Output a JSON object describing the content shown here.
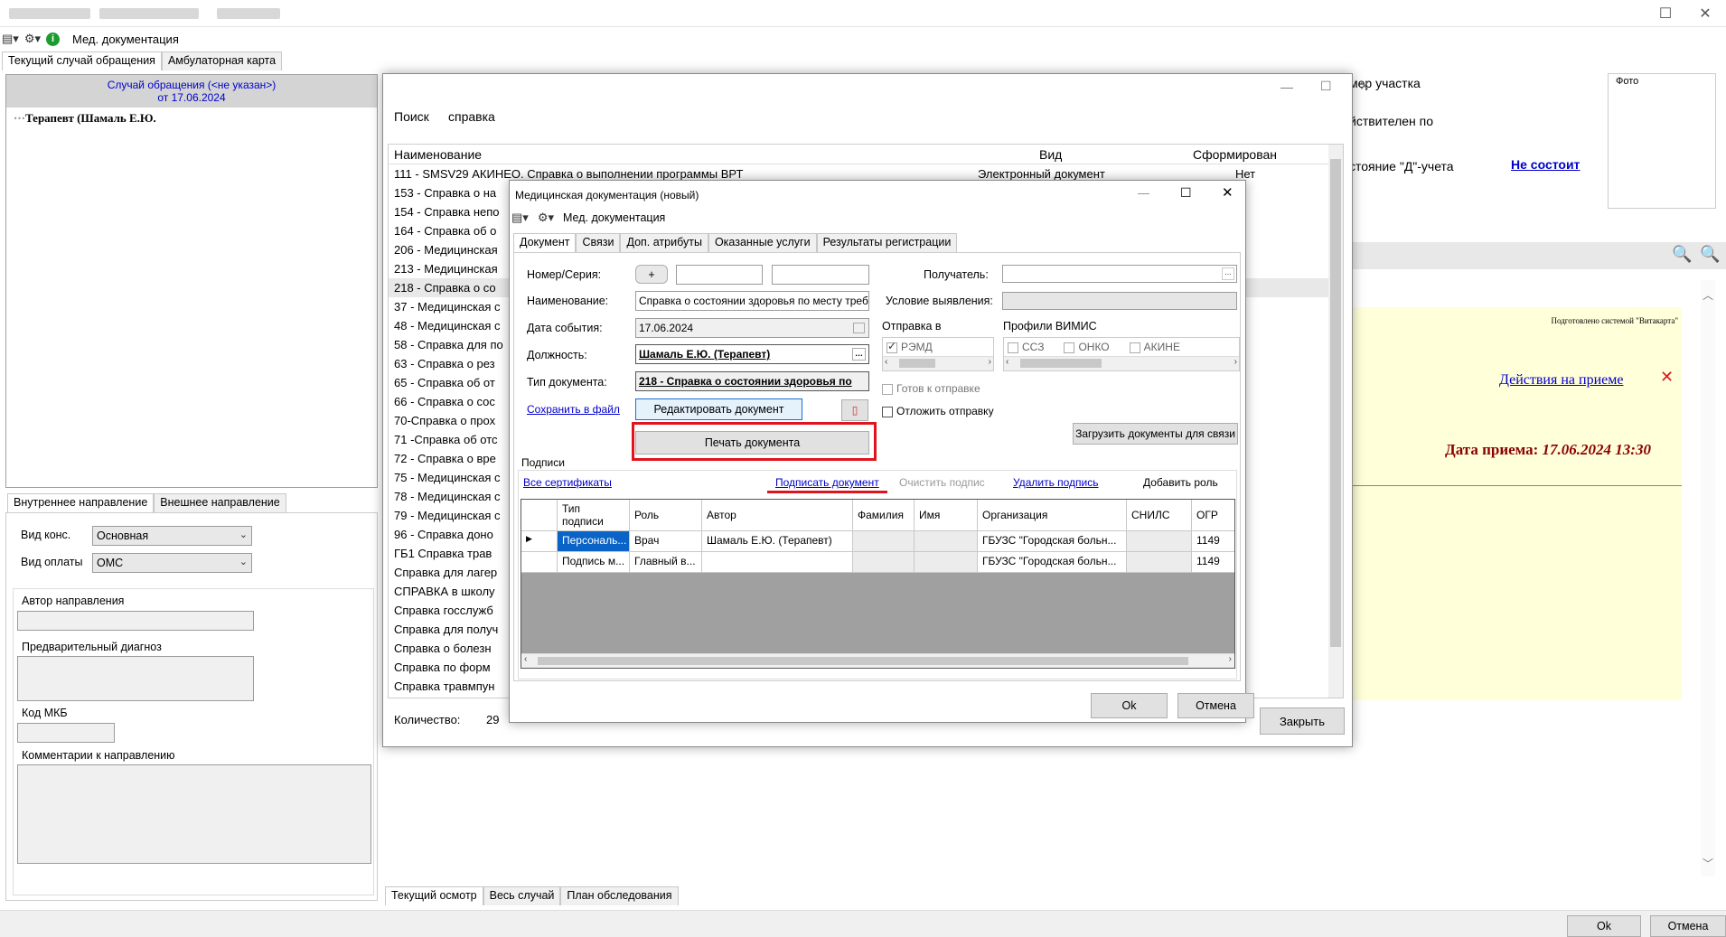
{
  "main": {
    "toolbar": {
      "med_docs": "Мед. документация"
    },
    "tabs": [
      "Текущий случай обращения",
      "Амбулаторная карта"
    ],
    "case": {
      "title": "Случай обращения (<не указан>)",
      "date": "от 17.06.2024",
      "tree_item": "Терапевт (Шамаль Е.Ю."
    },
    "direction_tabs": [
      "Внутреннее направление",
      "Внешнее направление"
    ],
    "vid_kons_label": "Вид конс.",
    "vid_kons_value": "Основная",
    "vid_oplaty_label": "Вид оплаты",
    "vid_oplaty_value": "ОМС",
    "author_label": "Автор направления",
    "diag_label": "Предварительный диагноз",
    "mkb_label": "Код МКБ",
    "comment_label": "Комментарии к направлению",
    "right": {
      "uchastok": "мер участка",
      "valid": "йствителен по",
      "d_uchet": "стояние \"Д\"-учета",
      "ne_sostoit": "Не состоит",
      "photo": "Фото",
      "vitakarta": "Подготовлено системой \"Витакарта\"",
      "actions_link": "Действия на приеме",
      "visit_date_label": "Дата приема: ",
      "visit_date_value": "17.06.2024 13:30"
    },
    "bottom_tabs": [
      "Текущий осмотр",
      "Весь случай",
      "План обследования"
    ],
    "ok": "Ok",
    "cancel": "Отмена"
  },
  "search_dialog": {
    "search_label": "Поиск",
    "search_value": "справка",
    "columns": [
      "Наименование",
      "Вид",
      "Сформирован"
    ],
    "first_row": {
      "name": "111 - SMSV29 АКИНЕО. Справка о выполнении программы ВРТ",
      "vid": "Электронный документ",
      "status": "Нет"
    },
    "rows": [
      "153 - Справка о на",
      "154 - Справка непо",
      "164 - Справка об о",
      "206 - Медицинская",
      "213 - Медицинская",
      "218 - Справка о со",
      "37 - Медицинская с",
      "48 - Медицинская с",
      "58 - Справка для по",
      "63 - Справка о рез",
      "65 - Справка об от",
      "66 - Справка о сос",
      "70-Справка о прох",
      "71 -Справка об отс",
      "72 - Справка о вре",
      "75 - Медицинская с",
      "78 - Медицинская с",
      "79 - Медицинская с",
      "96 - Справка доно",
      "ГБ1 Справка трав",
      "Справка для лагер",
      "СПРАВКА в школу",
      "Справка госслужб",
      "Справка для получ",
      "Справка о болезн",
      "Справка по форм",
      "Справка травмпун"
    ],
    "count_label": "Количество:",
    "count_value": "29",
    "close": "Закрыть"
  },
  "doc_dialog": {
    "title": "Медицинская документация (новый)",
    "toolbar_label": "Мед. документация",
    "tabs": [
      "Документ",
      "Связи",
      "Доп. атрибуты",
      "Оказанные услуги",
      "Результаты регистрации"
    ],
    "nomer_label": "Номер/Серия:",
    "plus": "+",
    "name_label": "Наименование:",
    "name_value": "Справка о состоянии здоровья по месту требо",
    "date_label": "Дата события:",
    "date_value": "17.06.2024",
    "position_label": "Должность:",
    "position_value": "Шамаль Е.Ю. (Терапевт)",
    "doctype_label": "Тип документа:",
    "doctype_value": "218 - Справка о состоянии здоровья по",
    "save_link": "Сохранить в файл",
    "edit_btn": "Редактировать документ",
    "print_btn": "Печать документа",
    "receiver_label": "Получатель:",
    "condition_label": "Условие выявления:",
    "send_label": "Отправка в",
    "remd": "РЭМД",
    "vimis_label": "Профили ВИМИС",
    "vimis": [
      "ССЗ",
      "ОНКО",
      "АКИНЕ"
    ],
    "ready": "Готов к отправке",
    "postpone": "Отложить отправку",
    "load_btn": "Загрузить документы для связи",
    "signatures_label": "Подписи",
    "all_certs": "Все сертификаты",
    "sign_link": "Подписать документ",
    "clear_link": "Очистить подпис",
    "delete_link": "Удалить подпись",
    "add_role": "Добавить роль",
    "grid_headers": [
      "Тип подписи",
      "Роль",
      "Автор",
      "Фамилия",
      "Имя",
      "Организация",
      "СНИЛС",
      "ОГР"
    ],
    "grid_rows": [
      [
        "Персональ...",
        "Врач",
        "Шамаль Е.Ю. (Терапевт)",
        "",
        "",
        "ГБУЗС \"Городская больн...",
        "",
        "1149"
      ],
      [
        "Подпись м...",
        "Главный в...",
        "",
        "",
        "",
        "ГБУЗС \"Городская больн...",
        "",
        "1149"
      ]
    ],
    "ok": "Ok",
    "cancel": "Отмена"
  },
  "colors": {
    "highlight_red": "#e0141e",
    "link_blue": "#0000cc",
    "note_yellow": "#ffffd9",
    "visit_red": "#8b0000"
  }
}
